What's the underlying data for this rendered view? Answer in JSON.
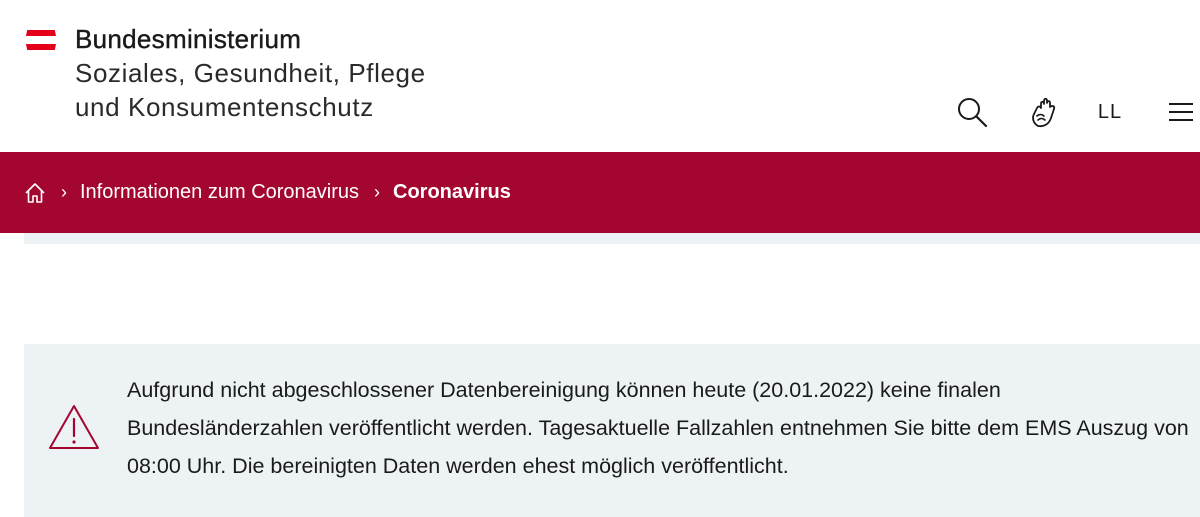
{
  "header": {
    "ministry_title": "Bundesministerium",
    "ministry_line1": "Soziales, Gesundheit, Pflege",
    "ministry_line2": "und Konsumentenschutz",
    "logo_icon": "austrian-flag-logo-icon",
    "tools": {
      "search_icon": "search-icon",
      "sign_language_icon": "sign-language-icon",
      "easy_language_label": "LL",
      "menu_icon": "hamburger-menu-icon"
    }
  },
  "breadcrumb": {
    "home_icon": "home-icon",
    "items": [
      {
        "label": "Informationen zum Coronavirus"
      },
      {
        "label": "Coronavirus"
      }
    ]
  },
  "notice": {
    "icon": "warning-triangle-icon",
    "text": "Aufgrund nicht abgeschlossener Datenbereinigung können heute (20.01.2022) keine finalen Bundesländerzahlen veröffentlicht werden. Tagesaktuelle Fallzahlen entnehmen Sie bitte dem EMS Auszug von 08:00 Uhr. Die bereinigten Daten werden ehest möglich veröffentlicht."
  },
  "colors": {
    "brand_red": "#a3072f",
    "flag_red": "#e4001b",
    "notice_bg": "#edf2f5"
  }
}
